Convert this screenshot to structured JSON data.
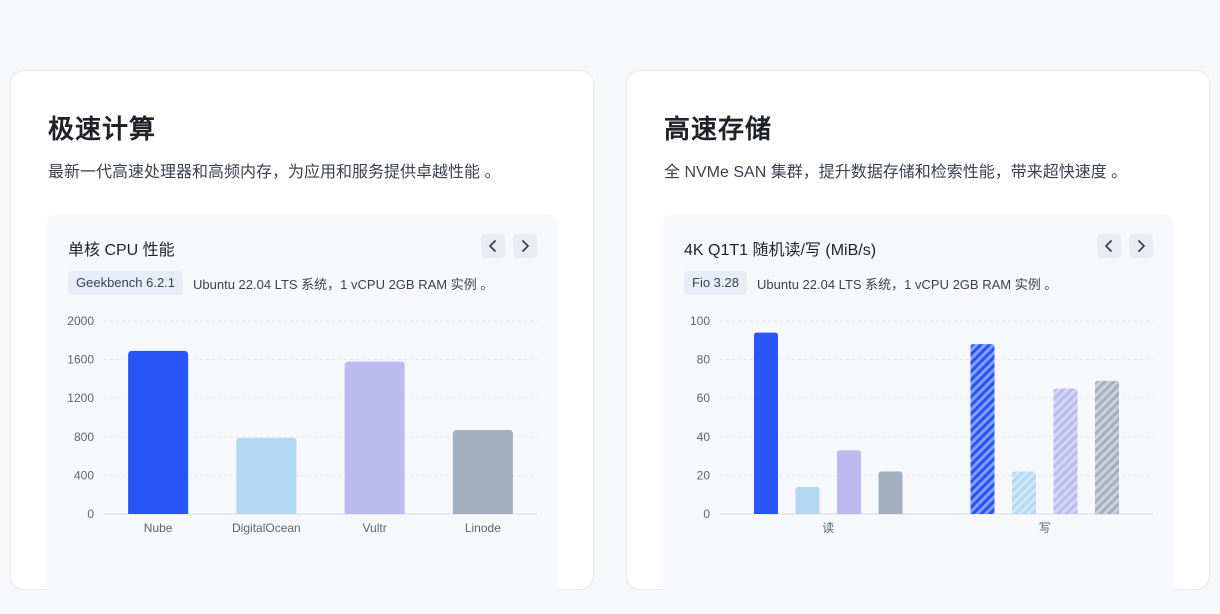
{
  "cards": [
    {
      "title": "极速计算",
      "description": "最新一代高速处理器和高频内存，为应用和服务提供卓越性能 。",
      "panel": {
        "title": "单核 CPU 性能",
        "tag": "Geekbench 6.2.1",
        "note": "Ubuntu 22.04 LTS 系统，1 vCPU 2GB RAM 实例 。"
      }
    },
    {
      "title": "高速存储",
      "description": "全 NVMe SAN 集群，提升数据存储和检索性能，带来超快速度 。",
      "panel": {
        "title": "4K Q1T1 随机读/写 (MiB/s)",
        "tag": "Fio 3.28",
        "note": "Ubuntu 22.04 LTS 系统，1 vCPU 2GB RAM 实例 。"
      }
    }
  ],
  "chart_data": [
    {
      "type": "bar",
      "categories": [
        "Nube",
        "DigitalOcean",
        "Vultr",
        "Linode"
      ],
      "values": [
        1690,
        790,
        1580,
        870
      ],
      "colors": [
        "#2755f7",
        "#b3d9f2",
        "#bcbaf0",
        "#a3b0c0"
      ],
      "ylim": [
        0,
        2000
      ],
      "yticks": [
        "0",
        "400",
        "800",
        "1200",
        "1600",
        "2000"
      ],
      "grid": true
    },
    {
      "type": "bar",
      "categories": [
        "读",
        "写"
      ],
      "series": [
        {
          "values": [
            94,
            88
          ],
          "color": "#2755f7"
        },
        {
          "values": [
            14,
            22
          ],
          "color": "#b3d9f2"
        },
        {
          "values": [
            33,
            65
          ],
          "color": "#bcbaf0"
        },
        {
          "values": [
            22,
            69
          ],
          "color": "#a3b0c0"
        }
      ],
      "hatched_category": "写",
      "ylim": [
        0,
        100
      ],
      "yticks": [
        "0",
        "20",
        "40",
        "60",
        "80",
        "100"
      ],
      "grid": true
    }
  ]
}
